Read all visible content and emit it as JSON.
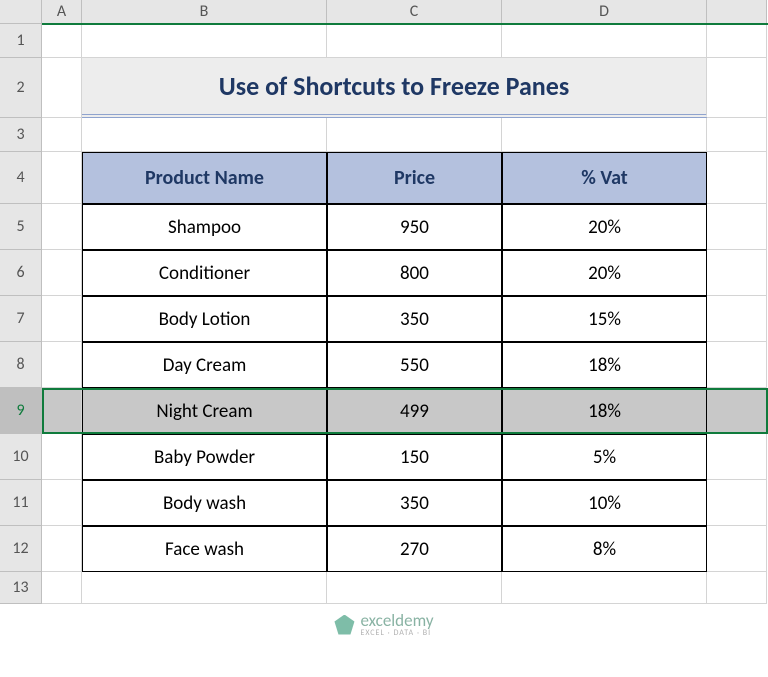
{
  "columns": [
    "A",
    "B",
    "C",
    "D"
  ],
  "rows": [
    "1",
    "2",
    "3",
    "4",
    "5",
    "6",
    "7",
    "8",
    "9",
    "10",
    "11",
    "12",
    "13"
  ],
  "title": "Use of Shortcuts to Freeze Panes",
  "headers": {
    "product": "Product Name",
    "price": "Price",
    "vat": "% Vat"
  },
  "data": [
    {
      "product": "Shampoo",
      "price": "950",
      "vat": "20%"
    },
    {
      "product": "Conditioner",
      "price": "800",
      "vat": "20%"
    },
    {
      "product": "Body Lotion",
      "price": "350",
      "vat": "15%"
    },
    {
      "product": "Day Cream",
      "price": "550",
      "vat": "18%"
    },
    {
      "product": "Night Cream",
      "price": "499",
      "vat": "18%"
    },
    {
      "product": "Baby Powder",
      "price": "150",
      "vat": "5%"
    },
    {
      "product": "Body wash",
      "price": "350",
      "vat": "10%"
    },
    {
      "product": "Face wash",
      "price": "270",
      "vat": "8%"
    }
  ],
  "selected_row_index": 4,
  "watermark": {
    "main": "exceldemy",
    "sub": "EXCEL · DATA · BI"
  },
  "chart_data": {
    "type": "table",
    "title": "Use of Shortcuts to Freeze Panes",
    "columns": [
      "Product Name",
      "Price",
      "% Vat"
    ],
    "rows": [
      [
        "Shampoo",
        950,
        "20%"
      ],
      [
        "Conditioner",
        800,
        "20%"
      ],
      [
        "Body Lotion",
        350,
        "15%"
      ],
      [
        "Day Cream",
        550,
        "18%"
      ],
      [
        "Night Cream",
        499,
        "18%"
      ],
      [
        "Baby Powder",
        150,
        "5%"
      ],
      [
        "Body wash",
        350,
        "10%"
      ],
      [
        "Face wash",
        270,
        "8%"
      ]
    ]
  }
}
